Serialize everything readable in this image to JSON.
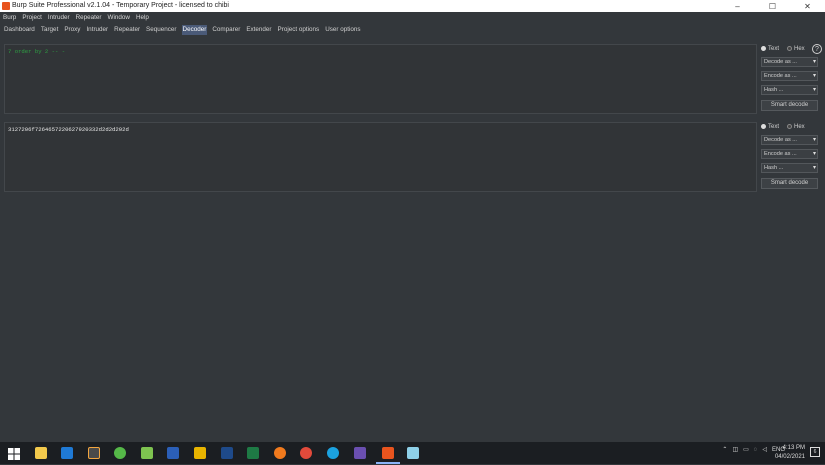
{
  "window": {
    "title": "Burp Suite Professional v2.1.04 - Temporary Project - licensed to chibi",
    "controls": [
      "–",
      "☐",
      "✕"
    ]
  },
  "menu": [
    "Burp",
    "Project",
    "Intruder",
    "Repeater",
    "Window",
    "Help"
  ],
  "tabs": [
    "Dashboard",
    "Target",
    "Proxy",
    "Intruder",
    "Repeater",
    "Sequencer",
    "Decoder",
    "Comparer",
    "Extender",
    "Project options",
    "User options"
  ],
  "active_tab": "Decoder",
  "decoder": {
    "panels": [
      {
        "text": "7 order by 2 -- -",
        "text_color": "#2ea043",
        "radio_text": "Text",
        "radio_hex": "Hex",
        "decode_as": "Decode as ...",
        "encode_as": "Encode as ...",
        "hash": "Hash ...",
        "smart_decode": "Smart decode"
      },
      {
        "text": "3127206f7264657220627920332d2d2d202d",
        "text_color": "#e6e6e6",
        "radio_text": "Text",
        "radio_hex": "Hex",
        "decode_as": "Decode as ...",
        "encode_as": "Encode as ...",
        "hash": "Hash ...",
        "smart_decode": "Smart decode"
      }
    ],
    "help_icon": "?"
  },
  "taskbar": {
    "icons": [
      "windows-start-icon",
      "file-explorer-icon",
      "vscode-icon",
      "sublime-icon",
      "green-app-icon",
      "notepad-plus-icon",
      "word-icon",
      "yellow-app-icon",
      "dark-app-icon",
      "excel-icon",
      "firefox-icon",
      "chrome-icon",
      "edge-icon",
      "purple-app-icon",
      "burp-icon",
      "notepad-icon"
    ],
    "language": "ENG",
    "time": "4:13 PM",
    "date": "04/02/2021",
    "notification_count": "6"
  }
}
